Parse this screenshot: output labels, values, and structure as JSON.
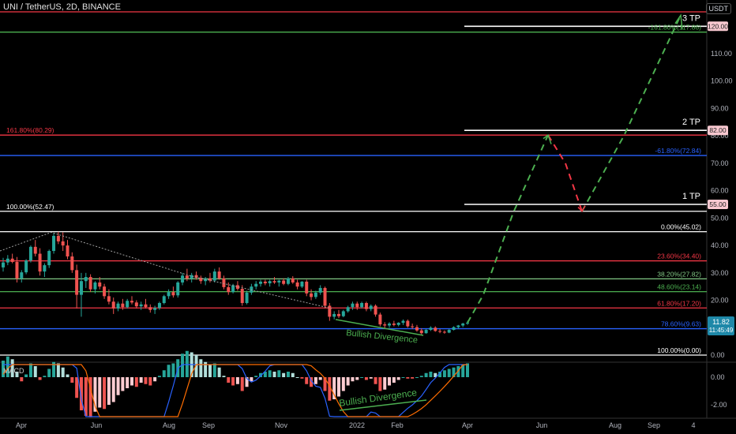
{
  "header": {
    "symbol": "UNI / TetherUS, 2D, BINANCE",
    "currency": "USDT"
  },
  "chart_data": {
    "type": "candlestick",
    "price_axis": {
      "ticks": [
        0,
        10,
        20,
        30,
        40,
        50,
        60,
        70,
        80,
        90,
        100,
        110
      ],
      "tick_labels": [
        "0.00",
        "10.00",
        "20.00",
        "30.00",
        "40.00",
        "50.00",
        "60.00",
        "70.00",
        "80.00",
        "90.00",
        "100.00",
        "110.00"
      ]
    },
    "time_axis": {
      "labels": [
        "Apr",
        "Jun",
        "Aug",
        "Sep",
        "Nov",
        "2022",
        "Feb",
        "Apr",
        "Jun",
        "Aug",
        "Sep",
        "4"
      ]
    },
    "last_price": {
      "value": "11.82",
      "countdown": "11:45:49"
    },
    "fib_levels": [
      {
        "label": "100.00%(0.00)",
        "value": 0.0,
        "color": "#ffffff"
      },
      {
        "label": "78.60%(9.63)",
        "value": 9.63,
        "color": "#2962ff"
      },
      {
        "label": "61.80%(17.20)",
        "value": 17.2,
        "color": "#f23645"
      },
      {
        "label": "48.60%(23.14)",
        "value": 23.14,
        "color": "#4caf50"
      },
      {
        "label": "38.20%(27.82)",
        "value": 27.82,
        "color": "#81c784"
      },
      {
        "label": "23.60%(34.40)",
        "value": 34.4,
        "color": "#f23645"
      },
      {
        "label": "0.00%(45.02)",
        "value": 45.02,
        "color": "#ffffff"
      },
      {
        "label": "100.00%(52.47)",
        "value": 52.47,
        "color": "#ffffff"
      },
      {
        "label": "-61.80%(72.84)",
        "value": 72.84,
        "color": "#2962ff"
      },
      {
        "label": "161.80%(80.29)",
        "value": 80.29,
        "color": "#f23645"
      },
      {
        "label": "-161.80%(117.86)",
        "value": 117.86,
        "color": "#4caf50"
      }
    ],
    "targets": [
      {
        "label": "1 TP",
        "value": 55.0,
        "tag": "55.00"
      },
      {
        "label": "2 TP",
        "value": 82.0,
        "tag": "82.00"
      },
      {
        "label": "3 TP",
        "value": 120.0,
        "tag": "120.00"
      }
    ],
    "annotations": [
      "Bullish Divergence",
      "Bullish Divergence"
    ],
    "candles": [
      [
        32.0,
        35.5,
        30.5,
        33.8
      ],
      [
        33.8,
        36.5,
        32.8,
        35.2
      ],
      [
        35.2,
        37.0,
        33.5,
        34.0
      ],
      [
        34.0,
        35.8,
        26.5,
        28.0
      ],
      [
        28.0,
        31.0,
        26.5,
        30.2
      ],
      [
        30.2,
        35.0,
        29.5,
        34.5
      ],
      [
        34.5,
        40.0,
        33.8,
        39.5
      ],
      [
        39.5,
        42.0,
        36.0,
        37.0
      ],
      [
        37.0,
        39.0,
        29.0,
        30.5
      ],
      [
        30.5,
        33.5,
        28.5,
        32.8
      ],
      [
        32.8,
        38.5,
        31.8,
        38.0
      ],
      [
        38.0,
        44.5,
        37.0,
        43.5
      ],
      [
        43.5,
        45.0,
        40.5,
        41.5
      ],
      [
        41.5,
        44.8,
        38.0,
        40.0
      ],
      [
        40.0,
        42.0,
        35.0,
        36.0
      ],
      [
        36.0,
        37.5,
        30.0,
        31.0
      ],
      [
        31.0,
        33.0,
        17.0,
        22.0
      ],
      [
        22.0,
        30.0,
        14.0,
        27.0
      ],
      [
        27.0,
        30.0,
        24.5,
        28.5
      ],
      [
        28.5,
        29.5,
        23.0,
        24.0
      ],
      [
        24.0,
        27.0,
        22.5,
        26.5
      ],
      [
        26.5,
        28.5,
        24.0,
        25.0
      ],
      [
        25.0,
        26.0,
        20.5,
        21.5
      ],
      [
        21.5,
        24.0,
        18.5,
        19.5
      ],
      [
        19.5,
        21.0,
        15.0,
        17.0
      ],
      [
        17.0,
        19.5,
        16.0,
        18.8
      ],
      [
        18.8,
        20.5,
        16.5,
        17.5
      ],
      [
        17.5,
        20.5,
        17.0,
        19.8
      ],
      [
        19.8,
        21.5,
        18.5,
        19.2
      ],
      [
        19.2,
        20.0,
        17.0,
        17.8
      ],
      [
        17.8,
        19.5,
        16.5,
        18.5
      ],
      [
        18.5,
        20.5,
        17.0,
        17.5
      ],
      [
        17.5,
        18.5,
        15.5,
        16.5
      ],
      [
        16.5,
        18.0,
        15.0,
        17.2
      ],
      [
        17.2,
        19.5,
        16.5,
        19.0
      ],
      [
        19.0,
        22.0,
        18.5,
        21.5
      ],
      [
        21.5,
        24.0,
        20.5,
        23.0
      ],
      [
        23.0,
        25.0,
        21.0,
        21.8
      ],
      [
        21.8,
        27.0,
        21.0,
        26.5
      ],
      [
        26.5,
        30.0,
        25.5,
        29.0
      ],
      [
        29.0,
        31.5,
        27.0,
        28.0
      ],
      [
        28.0,
        30.0,
        26.5,
        29.2
      ],
      [
        29.2,
        30.5,
        27.5,
        28.2
      ],
      [
        28.2,
        29.0,
        26.0,
        27.0
      ],
      [
        27.0,
        28.5,
        25.5,
        28.0
      ],
      [
        28.0,
        30.0,
        26.5,
        27.2
      ],
      [
        27.2,
        31.5,
        26.5,
        30.5
      ],
      [
        30.5,
        32.0,
        27.5,
        28.0
      ],
      [
        28.0,
        29.0,
        24.0,
        24.8
      ],
      [
        24.8,
        26.5,
        22.0,
        23.0
      ],
      [
        23.0,
        26.0,
        22.5,
        25.5
      ],
      [
        25.5,
        27.0,
        23.5,
        24.2
      ],
      [
        24.2,
        25.5,
        18.0,
        19.0
      ],
      [
        19.0,
        23.5,
        18.5,
        22.8
      ],
      [
        22.8,
        26.0,
        22.0,
        25.0
      ],
      [
        25.0,
        27.0,
        24.0,
        26.0
      ],
      [
        26.0,
        27.5,
        25.0,
        26.8
      ],
      [
        26.8,
        27.5,
        25.5,
        26.2
      ],
      [
        26.2,
        27.5,
        25.0,
        27.0
      ],
      [
        27.0,
        28.5,
        26.0,
        26.5
      ],
      [
        26.5,
        27.5,
        25.0,
        27.2
      ],
      [
        27.2,
        28.0,
        25.5,
        26.0
      ],
      [
        26.0,
        28.5,
        25.5,
        28.0
      ],
      [
        28.0,
        28.8,
        26.0,
        26.5
      ],
      [
        26.5,
        27.5,
        24.0,
        25.0
      ],
      [
        25.0,
        27.0,
        24.5,
        26.8
      ],
      [
        26.8,
        27.5,
        21.5,
        22.5
      ],
      [
        22.5,
        24.0,
        20.0,
        21.2
      ],
      [
        21.2,
        23.5,
        20.5,
        22.8
      ],
      [
        22.8,
        25.5,
        22.0,
        24.5
      ],
      [
        24.5,
        25.0,
        17.0,
        18.0
      ],
      [
        18.0,
        19.0,
        12.5,
        14.0
      ],
      [
        14.0,
        16.0,
        13.0,
        15.0
      ],
      [
        15.0,
        16.5,
        13.5,
        14.2
      ],
      [
        14.2,
        16.5,
        13.8,
        16.0
      ],
      [
        16.0,
        18.0,
        15.5,
        17.5
      ],
      [
        17.5,
        19.5,
        16.5,
        18.8
      ],
      [
        18.8,
        19.5,
        16.5,
        17.5
      ],
      [
        17.5,
        19.5,
        17.0,
        19.0
      ],
      [
        19.0,
        19.5,
        16.0,
        16.8
      ],
      [
        16.8,
        18.5,
        16.0,
        18.0
      ],
      [
        18.0,
        18.5,
        14.0,
        14.8
      ],
      [
        14.8,
        15.5,
        10.5,
        11.2
      ],
      [
        11.2,
        12.0,
        9.5,
        10.8
      ],
      [
        10.8,
        12.0,
        10.0,
        11.5
      ],
      [
        11.5,
        12.5,
        10.5,
        11.0
      ],
      [
        11.0,
        12.0,
        10.5,
        11.8
      ],
      [
        11.8,
        13.0,
        11.0,
        12.5
      ],
      [
        12.5,
        13.0,
        10.0,
        10.5
      ],
      [
        10.5,
        11.5,
        9.5,
        10.2
      ],
      [
        10.2,
        11.0,
        8.5,
        9.0
      ],
      [
        9.0,
        9.8,
        7.5,
        8.0
      ],
      [
        8.0,
        9.5,
        7.8,
        9.2
      ],
      [
        9.2,
        10.5,
        8.8,
        10.0
      ],
      [
        10.0,
        10.5,
        8.5,
        8.8
      ],
      [
        8.8,
        9.5,
        8.0,
        8.5
      ],
      [
        8.5,
        9.0,
        7.8,
        8.2
      ],
      [
        8.2,
        9.5,
        8.0,
        9.2
      ],
      [
        9.2,
        10.5,
        9.0,
        10.2
      ],
      [
        10.2,
        11.0,
        9.5,
        10.8
      ],
      [
        10.8,
        11.8,
        10.2,
        11.5
      ],
      [
        11.5,
        12.5,
        11.0,
        11.82
      ]
    ],
    "macd": {
      "histogram": [
        1.2,
        1.5,
        1.3,
        0.4,
        -0.3,
        0.2,
        1.0,
        0.8,
        -0.2,
        0.1,
        0.6,
        1.1,
        1.0,
        0.7,
        0.2,
        -0.4,
        -1.5,
        -2.4,
        -2.8,
        -2.9,
        -2.5,
        -2.2,
        -2.3,
        -2.0,
        -1.8,
        -1.3,
        -1.0,
        -0.8,
        -0.6,
        -0.7,
        -0.4,
        -0.5,
        -0.6,
        -0.3,
        0.1,
        0.5,
        0.9,
        1.0,
        1.3,
        1.7,
        1.9,
        1.8,
        1.6,
        1.3,
        1.1,
        0.9,
        1.0,
        0.7,
        0.1,
        -0.4,
        -0.6,
        -0.5,
        -1.0,
        -0.7,
        -0.3,
        0.1,
        0.3,
        0.4,
        0.5,
        0.4,
        0.5,
        0.3,
        0.4,
        0.3,
        0.0,
        -0.1,
        -0.5,
        -0.7,
        -0.5,
        -0.2,
        -1.0,
        -1.7,
        -1.6,
        -1.4,
        -1.0,
        -0.6,
        -0.3,
        -0.2,
        0.0,
        -0.2,
        -0.1,
        -0.5,
        -1.0,
        -0.9,
        -0.6,
        -0.4,
        -0.2,
        0.0,
        -0.1,
        -0.1,
        0.0,
        0.1,
        0.3,
        0.4,
        0.3,
        0.4,
        0.5,
        0.6,
        0.7,
        0.8,
        0.9,
        1.0
      ],
      "ticks": [
        "0.00",
        "-2.00"
      ],
      "label": "MACD"
    }
  }
}
